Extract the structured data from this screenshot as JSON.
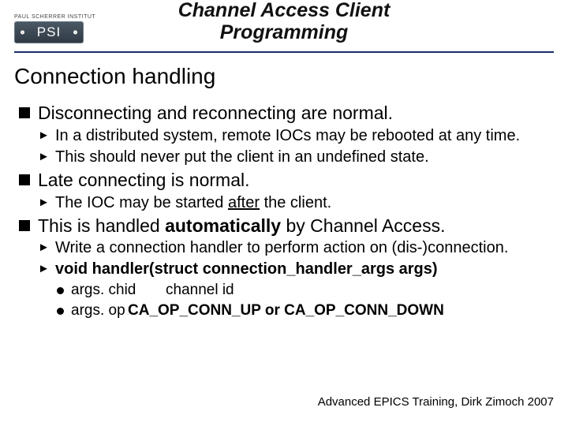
{
  "logo": {
    "top_text": "PAUL SCHERRER INSTITUT",
    "mark": "PSI"
  },
  "title": {
    "line1": "Channel Access Client",
    "line2": "Programming"
  },
  "section_heading": "Connection handling",
  "b1": {
    "text": "Disconnecting and reconnecting are normal.",
    "s1": "In a distributed system, remote IOCs may be rebooted at any time.",
    "s2": "This should never put the client in an undefined state."
  },
  "b2": {
    "text": "Late connecting is normal.",
    "s1_pre": "The IOC may be started ",
    "s1_u": "after",
    "s1_post": " the client."
  },
  "b3": {
    "pre": "This is handled ",
    "bold": "automatically",
    "post": " by Channel Access.",
    "s1": "Write a connection handler to perform action on (dis-)connection.",
    "s2": "void handler(struct connection_handler_args args)",
    "d1_a": "args. chid",
    "d1_b": "channel id",
    "d2_a": "args. op",
    "d2_b": "CA_OP_CONN_UP or CA_OP_CONN_DOWN"
  },
  "footer": "Advanced EPICS Training, Dirk Zimoch 2007"
}
